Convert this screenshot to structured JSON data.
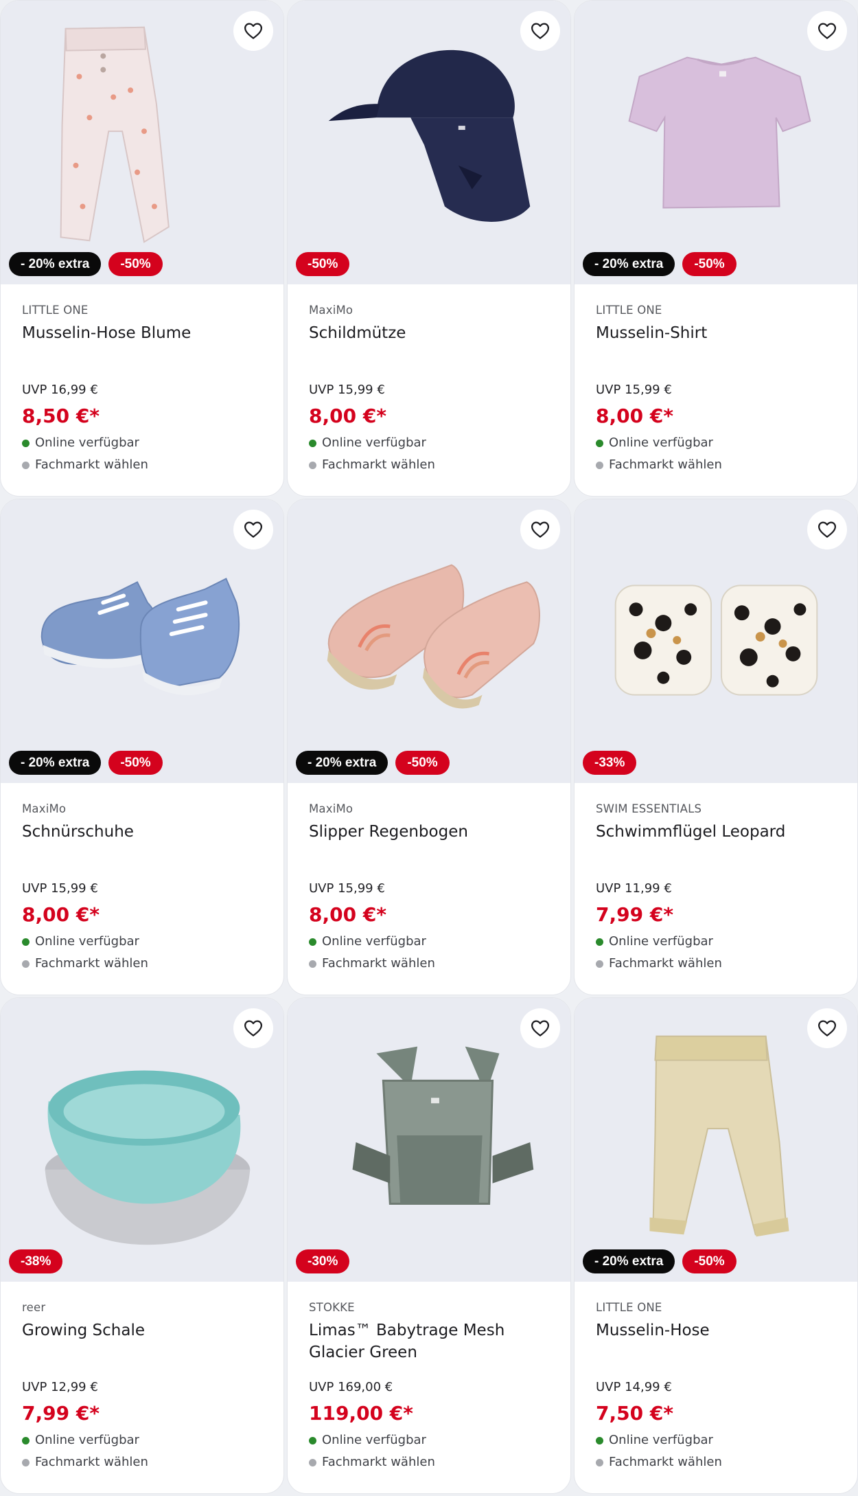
{
  "products": [
    {
      "brand": "LITTLE ONE",
      "name": "Musselin-Hose Blume",
      "uvp": "UVP 16,99 €",
      "price": "8,50 €*",
      "badges": [
        {
          "type": "extra",
          "label": "- 20% extra"
        },
        {
          "type": "sale",
          "label": "-50%"
        }
      ],
      "online": "Online verfügbar",
      "store": "Fachmarkt wählen",
      "image": "trousers-floral"
    },
    {
      "brand": "MaxiMo",
      "name": "Schildmütze",
      "uvp": "UVP 15,99 €",
      "price": "8,00 €*",
      "badges": [
        {
          "type": "sale",
          "label": "-50%"
        }
      ],
      "online": "Online verfügbar",
      "store": "Fachmarkt wählen",
      "image": "navy-cap"
    },
    {
      "brand": "LITTLE ONE",
      "name": "Musselin-Shirt",
      "uvp": "UVP 15,99 €",
      "price": "8,00 €*",
      "badges": [
        {
          "type": "extra",
          "label": "- 20% extra"
        },
        {
          "type": "sale",
          "label": "-50%"
        }
      ],
      "online": "Online verfügbar",
      "store": "Fachmarkt wählen",
      "image": "lilac-shirt"
    },
    {
      "brand": "MaxiMo",
      "name": "Schnürschuhe",
      "uvp": "UVP 15,99 €",
      "price": "8,00 €*",
      "badges": [
        {
          "type": "extra",
          "label": "- 20% extra"
        },
        {
          "type": "sale",
          "label": "-50%"
        }
      ],
      "online": "Online verfügbar",
      "store": "Fachmarkt wählen",
      "image": "blue-sneakers"
    },
    {
      "brand": "MaxiMo",
      "name": "Slipper Regenbogen",
      "uvp": "UVP 15,99 €",
      "price": "8,00 €*",
      "badges": [
        {
          "type": "extra",
          "label": "- 20% extra"
        },
        {
          "type": "sale",
          "label": "-50%"
        }
      ],
      "online": "Online verfügbar",
      "store": "Fachmarkt wählen",
      "image": "rainbow-slippers"
    },
    {
      "brand": "SWIM ESSENTIALS",
      "name": "Schwimmflügel Leopard",
      "uvp": "UVP 11,99 €",
      "price": "7,99 €*",
      "badges": [
        {
          "type": "sale",
          "label": "-33%"
        }
      ],
      "online": "Online verfügbar",
      "store": "Fachmarkt wählen",
      "image": "leopard-armbands"
    },
    {
      "brand": "reer",
      "name": "Growing Schale",
      "uvp": "UVP 12,99 €",
      "price": "7,99 €*",
      "badges": [
        {
          "type": "sale",
          "label": "-38%"
        }
      ],
      "online": "Online verfügbar",
      "store": "Fachmarkt wählen",
      "image": "bowls"
    },
    {
      "brand": "STOKKE",
      "name": "Limas™ Babytrage Mesh Glacier Green",
      "uvp": "UVP 169,00 €",
      "price": "119,00 €*",
      "badges": [
        {
          "type": "sale",
          "label": "-30%"
        }
      ],
      "online": "Online verfügbar",
      "store": "Fachmarkt wählen",
      "image": "baby-carrier"
    },
    {
      "brand": "LITTLE ONE",
      "name": "Musselin-Hose",
      "uvp": "UVP 14,99 €",
      "price": "7,50 €*",
      "badges": [
        {
          "type": "extra",
          "label": "- 20% extra"
        },
        {
          "type": "sale",
          "label": "-50%"
        }
      ],
      "online": "Online verfügbar",
      "store": "Fachmarkt wählen",
      "image": "beige-trousers"
    }
  ],
  "colors": {
    "sale": "#d4021d",
    "extra": "#0a0a0a",
    "online_dot": "#2a8a2c",
    "store_dot": "#a7a9ae",
    "image_bg": "#e9ebf2"
  },
  "icons": {
    "favorite": "heart-outline-icon"
  }
}
